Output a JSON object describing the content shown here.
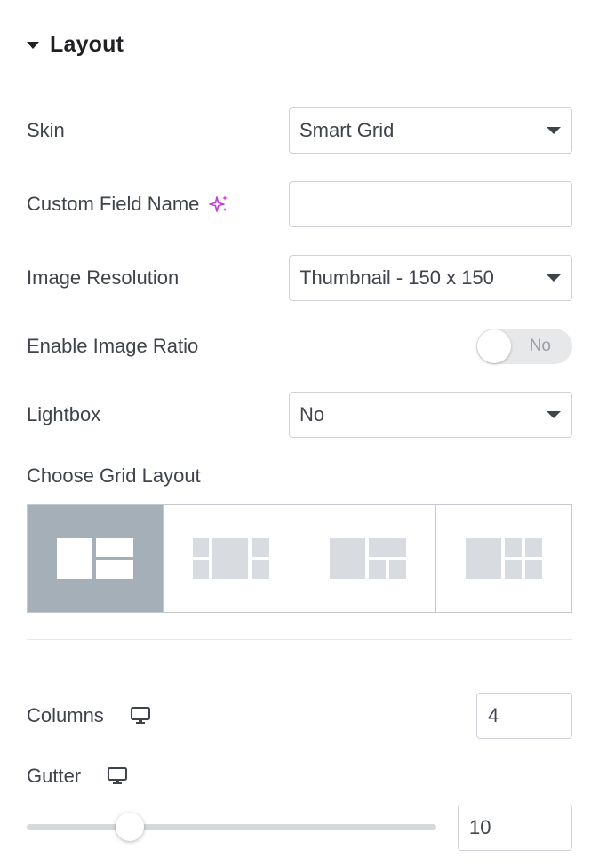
{
  "section": {
    "title": "Layout"
  },
  "skin": {
    "label": "Skin",
    "value": "Smart Grid"
  },
  "custom_field": {
    "label": "Custom Field Name",
    "value": "",
    "ai_icon": "ai-sparkle-icon"
  },
  "image_resolution": {
    "label": "Image Resolution",
    "value": "Thumbnail - 150 x 150"
  },
  "image_ratio": {
    "label": "Enable Image Ratio",
    "toggle_text": "No",
    "enabled": false
  },
  "lightbox": {
    "label": "Lightbox",
    "value": "No"
  },
  "grid_layout": {
    "label": "Choose Grid Layout",
    "options": [
      "layout-1",
      "layout-2",
      "layout-3",
      "layout-4"
    ],
    "selected_index": 0
  },
  "columns": {
    "label": "Columns",
    "value": "4",
    "device_icon": "desktop-icon"
  },
  "gutter": {
    "label": "Gutter",
    "value": "10",
    "device_icon": "desktop-icon",
    "slider_value": 10
  },
  "colors": {
    "selected_grid": "#a4afb7",
    "ai_icon": "#c13cd8",
    "tile": "#d8dbdf"
  }
}
